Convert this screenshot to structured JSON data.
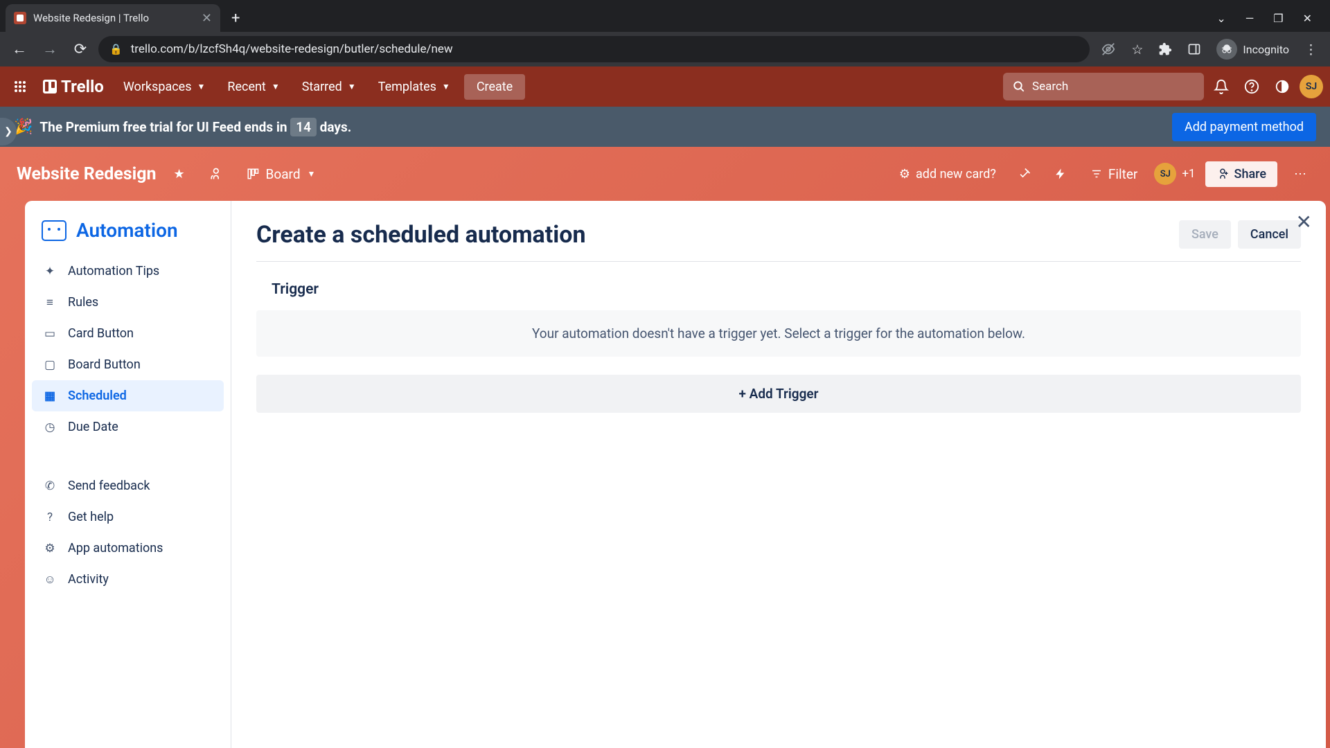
{
  "browser": {
    "tab_title": "Website Redesign | Trello",
    "url": "trello.com/b/lzcfSh4q/website-redesign/butler/schedule/new",
    "incognito_label": "Incognito"
  },
  "header": {
    "logo": "Trello",
    "nav": {
      "workspaces": "Workspaces",
      "recent": "Recent",
      "starred": "Starred",
      "templates": "Templates"
    },
    "create": "Create",
    "search_placeholder": "Search",
    "avatar": "SJ"
  },
  "banner": {
    "prefix": "The Premium free trial for UI Feed ends in",
    "days": "14",
    "suffix": "days.",
    "cta": "Add payment method"
  },
  "board": {
    "name": "Website Redesign",
    "view": "Board",
    "add_card": "add new card?",
    "filter": "Filter",
    "share": "Share",
    "plus_count": "+1"
  },
  "sidebar": {
    "title": "Automation",
    "items": [
      {
        "icon": "✦",
        "label": "Automation Tips"
      },
      {
        "icon": "≡",
        "label": "Rules"
      },
      {
        "icon": "▭",
        "label": "Card Button"
      },
      {
        "icon": "▢",
        "label": "Board Button"
      },
      {
        "icon": "▦",
        "label": "Scheduled"
      },
      {
        "icon": "◷",
        "label": "Due Date"
      }
    ],
    "footer": [
      {
        "icon": "✆",
        "label": "Send feedback"
      },
      {
        "icon": "?",
        "label": "Get help"
      },
      {
        "icon": "⚙",
        "label": "App automations"
      },
      {
        "icon": "☺",
        "label": "Activity"
      }
    ]
  },
  "content": {
    "title": "Create a scheduled automation",
    "save": "Save",
    "cancel": "Cancel",
    "trigger_label": "Trigger",
    "trigger_empty": "Your automation doesn't have a trigger yet. Select a trigger for the automation below.",
    "add_trigger": "+ Add Trigger"
  }
}
